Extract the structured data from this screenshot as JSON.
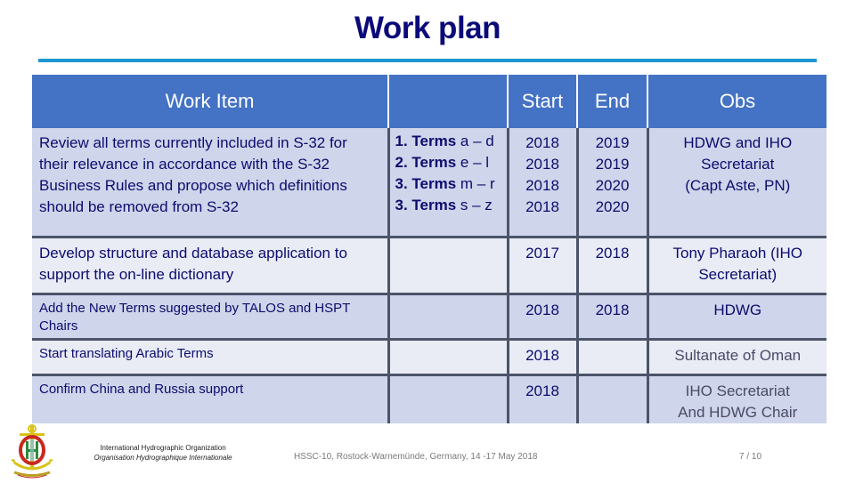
{
  "slide": {
    "title": "Work plan",
    "colors": {
      "title": "#0a0a78",
      "rule": "#1e96d2",
      "header_bg": "#4472c4",
      "row_dark": "#cfd5ea",
      "row_light": "#e9ebf5",
      "grid": "#4b5468"
    }
  },
  "table": {
    "headers": {
      "work_item": "Work Item",
      "terms": "",
      "start": "Start",
      "end": "End",
      "obs": "Obs"
    },
    "rows": [
      {
        "work_item": "Review all terms currently included in S-32 for their relevance in accordance with the S-32 Business Rules and propose which definitions should be removed from S-32",
        "terms": [
          {
            "num": "1. Terms",
            "range": "a – d"
          },
          {
            "num": "2. Terms",
            "range": "e – l"
          },
          {
            "num": "3. Terms",
            "range": "m – r"
          },
          {
            "num": "3. Terms",
            "range": "s – z"
          }
        ],
        "start": [
          "2018",
          "2018",
          "2018",
          "2018"
        ],
        "end": [
          "2019",
          "2019",
          "2020",
          "2020"
        ],
        "obs": [
          "HDWG and IHO",
          "Secretariat",
          "(Capt Aste, PN)"
        ]
      },
      {
        "work_item": "Develop structure and database application to support the on-line dictionary",
        "start": "2017",
        "end": "2018",
        "obs": [
          "Tony Pharaoh (IHO",
          "Secretariat)"
        ]
      },
      {
        "work_item": "Add the New Terms suggested by TALOS and HSPT Chairs",
        "start": "2018",
        "end": "2018",
        "obs": [
          "HDWG"
        ]
      },
      {
        "work_item": "Start translating Arabic Terms",
        "start": "2018",
        "end": "",
        "obs": [
          "Sultanate of Oman"
        ]
      },
      {
        "work_item": "Confirm China and Russia support",
        "start": "2018",
        "end": "",
        "obs": [
          "IHO Secretariat",
          "And HDWG Chair"
        ]
      }
    ]
  },
  "footer": {
    "logo_icon": "iho-emblem-icon",
    "org_name_en": "International Hydrographic Organization",
    "org_name_fr": "Organisation Hydrographique Internationale",
    "conference": "HSSC-10, Rostock-Warnemünde, Germany, 14 -17 May 2018",
    "page_number": "7 / 10"
  }
}
